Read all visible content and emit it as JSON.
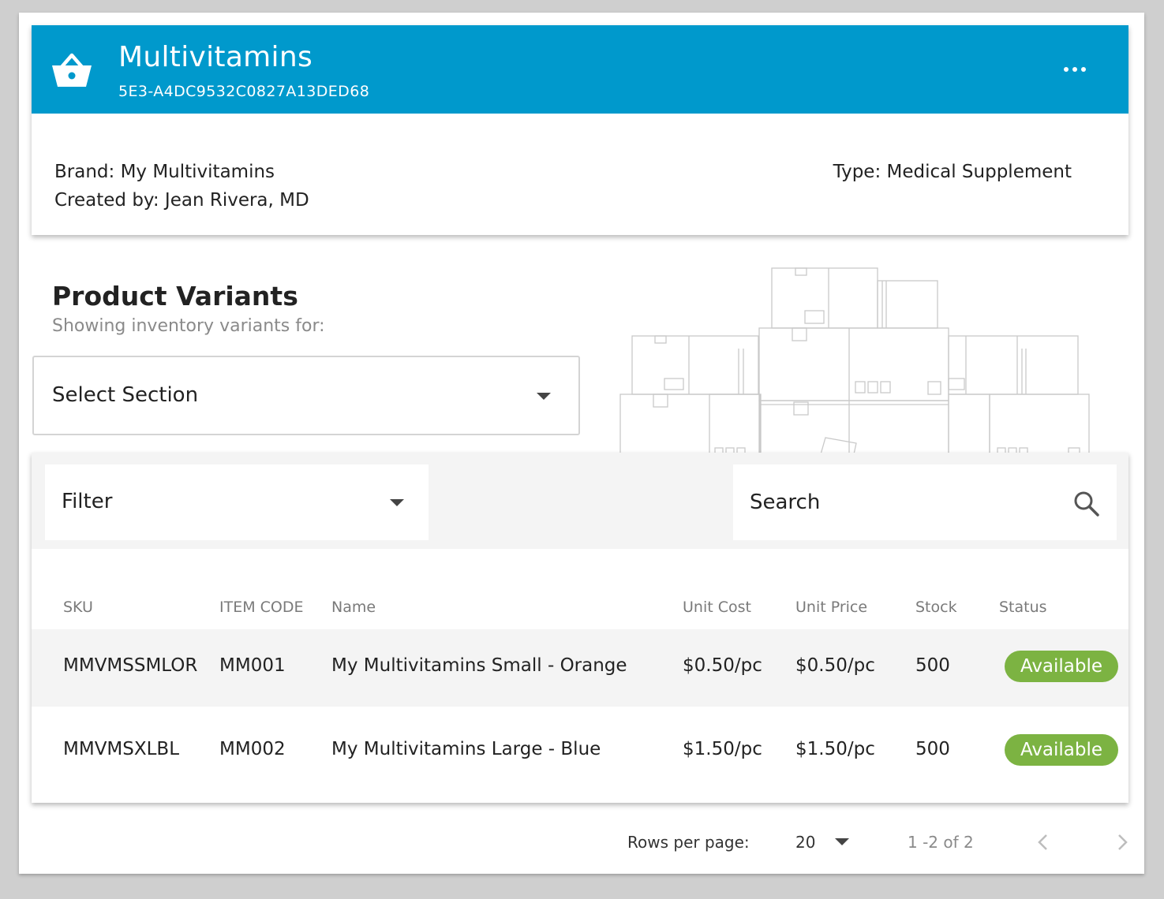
{
  "product": {
    "title": "Multivitamins",
    "id": "5E3-A4DC9532C0827A13DED68",
    "brand": "Brand: My Multivitamins",
    "created_by": "Created by: Jean Rivera, MD",
    "type": "Type: Medical Supplement",
    "header_color": "#0099cc"
  },
  "variants_section": {
    "title": "Product Variants",
    "subtitle": "Showing inventory variants for:",
    "select_label": "Select Section"
  },
  "toolbar": {
    "filter_label": "Filter",
    "search_placeholder": "Search"
  },
  "table": {
    "columns": [
      "SKU",
      "ITEM CODE",
      "Name",
      "Unit Cost",
      "Unit Price",
      "Stock",
      "Status"
    ],
    "rows": [
      {
        "sku": "MMVMSSMLOR",
        "item_code": "MM001",
        "name": "My Multivitamins Small - Orange",
        "unit_cost": "$0.50/pc",
        "unit_price": "$0.50/pc",
        "stock": "500",
        "status": "Available"
      },
      {
        "sku": "MMVMSXLBL",
        "item_code": "MM002",
        "name": "My Multivitamins Large - Blue",
        "unit_cost": "$1.50/pc",
        "unit_price": "$1.50/pc",
        "stock": "500",
        "status": "Available"
      }
    ],
    "status_color": "#7cb342"
  },
  "pagination": {
    "rows_label": "Rows per page:",
    "rows_value": "20",
    "range": "1 -2 of 2"
  },
  "icons": [
    "basket-icon",
    "more-icon",
    "chevron-down-icon",
    "search-icon",
    "chevron-left-icon",
    "chevron-right-icon"
  ]
}
